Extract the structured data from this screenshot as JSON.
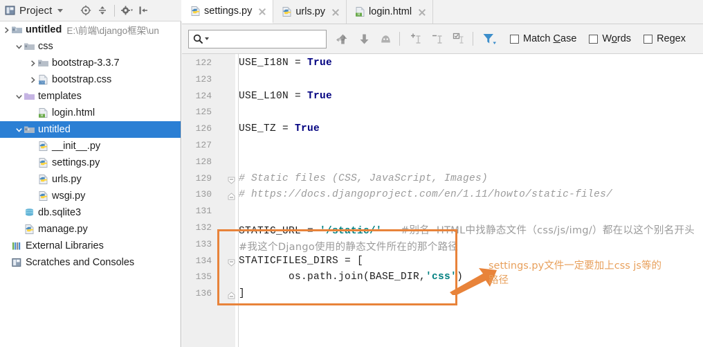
{
  "project_panel": {
    "title": "Project",
    "toolbar_buttons": [
      {
        "name": "locate-in-tree-icon",
        "label": "Select Opened File"
      },
      {
        "name": "collapse-all-icon",
        "label": "Collapse All"
      },
      {
        "name": "gear-icon",
        "label": "Settings"
      },
      {
        "name": "hide-panel-icon",
        "label": "Hide"
      }
    ],
    "tree": [
      {
        "label": "untitled",
        "path": "E:\\前端\\django框架\\un",
        "icon": "folder-module-icon",
        "depth": 0,
        "twisty": "collapsed-root",
        "bold": true,
        "selected": false
      },
      {
        "label": "css",
        "path": "",
        "icon": "folder-icon",
        "depth": 1,
        "twisty": "expanded",
        "bold": false,
        "selected": false
      },
      {
        "label": "bootstrap-3.3.7",
        "path": "",
        "icon": "folder-icon",
        "depth": 2,
        "twisty": "collapsed",
        "bold": false,
        "selected": false
      },
      {
        "label": "bootstrap.css",
        "path": "",
        "icon": "css-file-icon",
        "depth": 2,
        "twisty": "collapsed",
        "bold": false,
        "selected": false
      },
      {
        "label": "templates",
        "path": "",
        "icon": "folder-purple-icon",
        "depth": 1,
        "twisty": "expanded",
        "bold": false,
        "selected": false
      },
      {
        "label": "login.html",
        "path": "",
        "icon": "html-file-icon",
        "depth": 2,
        "twisty": "none",
        "bold": false,
        "selected": false
      },
      {
        "label": "untitled",
        "path": "",
        "icon": "folder-module-icon",
        "depth": 1,
        "twisty": "expanded",
        "bold": false,
        "selected": true
      },
      {
        "label": "__init__.py",
        "path": "",
        "icon": "python-file-icon",
        "depth": 2,
        "twisty": "none",
        "bold": false,
        "selected": false
      },
      {
        "label": "settings.py",
        "path": "",
        "icon": "python-file-icon",
        "depth": 2,
        "twisty": "none",
        "bold": false,
        "selected": false
      },
      {
        "label": "urls.py",
        "path": "",
        "icon": "python-file-icon",
        "depth": 2,
        "twisty": "none",
        "bold": false,
        "selected": false
      },
      {
        "label": "wsgi.py",
        "path": "",
        "icon": "python-file-icon",
        "depth": 2,
        "twisty": "none",
        "bold": false,
        "selected": false
      },
      {
        "label": "db.sqlite3",
        "path": "",
        "icon": "database-icon",
        "depth": 1,
        "twisty": "none",
        "bold": false,
        "selected": false
      },
      {
        "label": "manage.py",
        "path": "",
        "icon": "python-file-icon",
        "depth": 1,
        "twisty": "none",
        "bold": false,
        "selected": false
      },
      {
        "label": "External Libraries",
        "path": "",
        "icon": "libraries-icon",
        "depth": 0,
        "twisty": "none",
        "bold": false,
        "selected": false
      },
      {
        "label": "Scratches and Consoles",
        "path": "",
        "icon": "scratches-icon",
        "depth": 0,
        "twisty": "none",
        "bold": false,
        "selected": false
      }
    ]
  },
  "tabs": [
    {
      "label": "settings.py",
      "icon": "python-file-icon",
      "active": true
    },
    {
      "label": "urls.py",
      "icon": "python-file-icon",
      "active": false
    },
    {
      "label": "login.html",
      "icon": "html-file-icon",
      "active": false
    }
  ],
  "find_bar": {
    "search_value": "",
    "search_placeholder": "",
    "buttons": [
      {
        "name": "find-previous-icon",
        "label": "Previous Occurrence"
      },
      {
        "name": "find-next-icon",
        "label": "Next Occurrence"
      },
      {
        "name": "find-all-icon",
        "label": "Select All Occurrences"
      },
      {
        "name": "add-selection-icon",
        "label": "Add Selection for Next Occurrence"
      },
      {
        "name": "remove-selection-icon",
        "label": "Remove Selection"
      },
      {
        "name": "select-all-occurrences-icon",
        "label": "Select All Occurrences"
      },
      {
        "name": "filter-icon",
        "label": "Filter"
      }
    ],
    "options": [
      {
        "label": "Match Case",
        "mnemonic": "C",
        "checked": false
      },
      {
        "label": "Words",
        "mnemonic": "o",
        "checked": false
      },
      {
        "label": "Regex",
        "mnemonic": "",
        "checked": false
      }
    ]
  },
  "editor": {
    "first_line_number": 122,
    "last_line_number": 136,
    "lines": [
      {
        "num": 122,
        "segments": [
          {
            "t": "USE_I18N = ",
            "c": "plain"
          },
          {
            "t": "True",
            "c": "kw-true"
          }
        ],
        "fold": "none"
      },
      {
        "num": 123,
        "segments": [],
        "fold": "none"
      },
      {
        "num": 124,
        "segments": [
          {
            "t": "USE_L10N = ",
            "c": "plain"
          },
          {
            "t": "True",
            "c": "kw-true"
          }
        ],
        "fold": "none"
      },
      {
        "num": 125,
        "segments": [],
        "fold": "none"
      },
      {
        "num": 126,
        "segments": [
          {
            "t": "USE_TZ = ",
            "c": "plain"
          },
          {
            "t": "True",
            "c": "kw-true"
          }
        ],
        "fold": "none"
      },
      {
        "num": 127,
        "segments": [],
        "fold": "none"
      },
      {
        "num": 128,
        "segments": [],
        "fold": "none"
      },
      {
        "num": 129,
        "segments": [
          {
            "t": "# Static files (CSS, JavaScript, Images)",
            "c": "cmt"
          }
        ],
        "fold": "start"
      },
      {
        "num": 130,
        "segments": [
          {
            "t": "# https://docs.djangoproject.com/en/1.11/howto/static-files/",
            "c": "cmt"
          }
        ],
        "fold": "end"
      },
      {
        "num": 131,
        "segments": [],
        "fold": "none"
      },
      {
        "num": 132,
        "segments": [
          {
            "t": "STATIC_URL = ",
            "c": "plain"
          },
          {
            "t": "'/static/'",
            "c": "str"
          },
          {
            "t": "   ",
            "c": "plain"
          },
          {
            "t": "#别名  HTML中找静态文件（css/js/img/）都在以这个别名开头",
            "c": "cmt"
          }
        ],
        "fold": "none"
      },
      {
        "num": 133,
        "segments": [
          {
            "t": "#我这个Django使用的静态文件所在的那个路径",
            "c": "cmt"
          }
        ],
        "fold": "none"
      },
      {
        "num": 134,
        "segments": [
          {
            "t": "STATICFILES_DIRS = [",
            "c": "plain"
          }
        ],
        "fold": "start"
      },
      {
        "num": 135,
        "segments": [
          {
            "t": "        os.path.join(BASE_DIR,",
            "c": "plain"
          },
          {
            "t": "'css'",
            "c": "str"
          },
          {
            "t": ")",
            "c": "plain"
          }
        ],
        "fold": "none"
      },
      {
        "num": 136,
        "segments": [
          {
            "t": "]",
            "c": "plain"
          }
        ],
        "fold": "end"
      }
    ]
  },
  "annotation": {
    "text": "settings.py文件一定要加上css js等的\n路径",
    "box_color": "#e8833a",
    "text_color": "#e8a05c"
  },
  "colors": {
    "selection_blue": "#2b7fd4",
    "toolbar_bg": "#f2f2f2",
    "gutter_bg": "#efefef",
    "keyword": "#000080",
    "string": "#008080",
    "comment": "#9b9b9b"
  }
}
